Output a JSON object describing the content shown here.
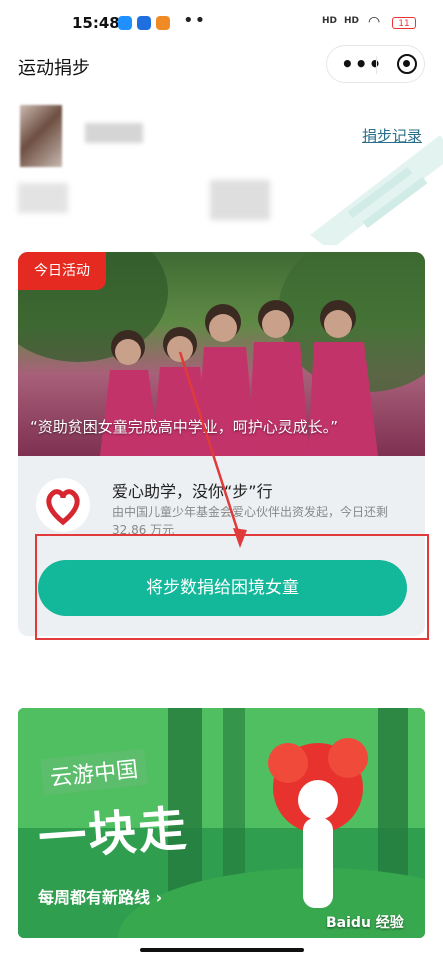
{
  "status": {
    "time": "15:48",
    "battery": "11",
    "sim1": "HD",
    "sim2": "HD"
  },
  "nav": {
    "title": "运动捐步",
    "more_icon": "more-dots-icon",
    "close_icon": "target-icon"
  },
  "user": {
    "record_link": "捐步记录"
  },
  "activity": {
    "badge": "今日活动",
    "quote": "“资助贫困女童完成高中学业，呵护心灵成长。”",
    "title": "爱心助学，没你“步”行",
    "desc": "由中国儿童少年基金会爱心伙伴出资发起，今日还剩 32.86 万元",
    "donate_button": "将步数捐给困境女童"
  },
  "banner": {
    "title": "云游中国",
    "headline": "一块走",
    "subtitle": "每周都有新路线 ›",
    "watermark": "Baidu 经验"
  },
  "colors": {
    "accent": "#13b89a",
    "badge": "#e52a21",
    "link": "#2a6f8a",
    "annotation": "#e03a3a"
  }
}
